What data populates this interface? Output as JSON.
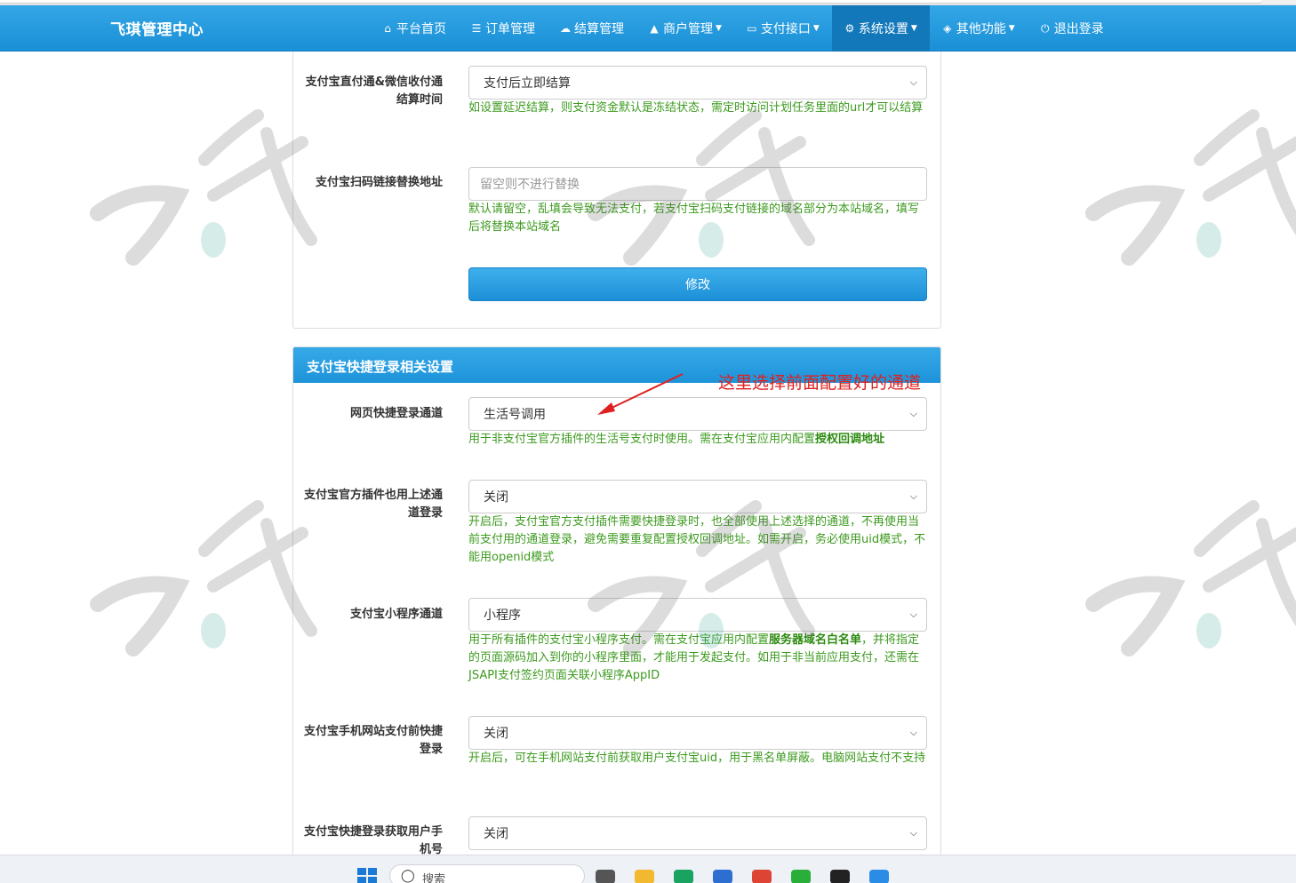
{
  "navbar": {
    "brand": "飞琪管理中心",
    "items": [
      {
        "label": "平台首页",
        "icon": "home-icon",
        "dropdown": false
      },
      {
        "label": "订单管理",
        "icon": "list-icon",
        "dropdown": false
      },
      {
        "label": "结算管理",
        "icon": "cloud-icon",
        "dropdown": false
      },
      {
        "label": "商户管理",
        "icon": "user-icon",
        "dropdown": true
      },
      {
        "label": "支付接口",
        "icon": "credit-card-icon",
        "dropdown": true
      },
      {
        "label": "系统设置",
        "icon": "gear-icon",
        "dropdown": true,
        "active": true
      },
      {
        "label": "其他功能",
        "icon": "cube-icon",
        "dropdown": true
      },
      {
        "label": "退出登录",
        "icon": "power-icon",
        "dropdown": false
      }
    ]
  },
  "settlement_card": {
    "rows": [
      {
        "label": "支付宝直付通&微信收付通结算时间",
        "value": "支付后立即结算",
        "help": "如设置延迟结算，则支付资金默认是冻结状态，需定时访问计划任务里面的url才可以结算"
      },
      {
        "label": "支付宝扫码链接替换地址",
        "placeholder": "留空则不进行替换",
        "help": "默认请留空，乱填会导致无法支付，若支付宝扫码支付链接的域名部分为本站域名，填写后将替换本站域名"
      }
    ],
    "submit_label": "修改"
  },
  "quick_login_card": {
    "title": "支付宝快捷登录相关设置",
    "annotation": "这里选择前面配置好的通道",
    "rows": [
      {
        "label": "网页快捷登录通道",
        "value": "生活号调用",
        "help_plain": "用于非支付宝官方插件的生活号支付时使用。需在支付宝应用内配置",
        "help_bold": "授权回调地址"
      },
      {
        "label": "支付宝官方插件也用上述通道登录",
        "value": "关闭",
        "help": "开启后，支付宝官方支付插件需要快捷登录时，也全部使用上述选择的通道，不再使用当前支付用的通道登录，避免需要重复配置授权回调地址。如需开启，务必使用uid模式，不能用openid模式"
      },
      {
        "label": "支付宝小程序通道",
        "value": "小程序",
        "help_plain": "用于所有插件的支付宝小程序支付。需在支付宝应用内配置",
        "help_bold": "服务器域名白名单",
        "help_rest": "，并将指定的页面源码加入到你的小程序里面，才能用于发起支付。如用于非当前应用支付，还需在JSAPI支付签约页面关联小程序AppID"
      },
      {
        "label": "支付宝手机网站支付前快捷登录",
        "value": "关闭",
        "help": "开启后，可在手机网站支付前获取用户支付宝uid，用于黑名单屏蔽。电脑网站支付不支持"
      },
      {
        "label": "支付宝快捷登录获取用户手机号",
        "value": "关闭"
      }
    ]
  },
  "taskbar": {
    "search_placeholder": "搜索"
  }
}
